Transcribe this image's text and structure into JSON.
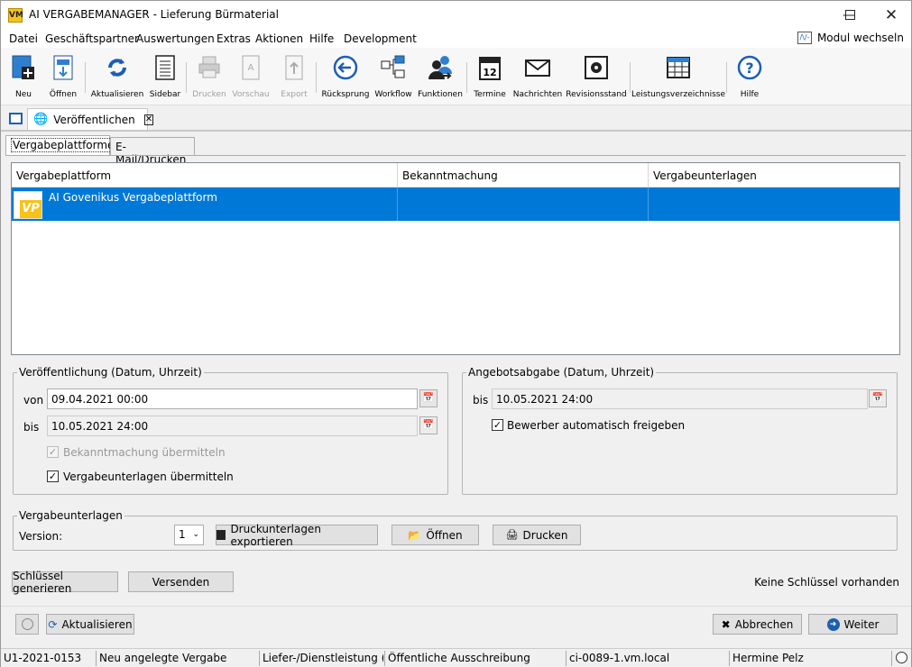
{
  "window": {
    "title": "AI VERGABEMANAGER - Lieferung Bürmaterial",
    "icon_text": "VM"
  },
  "menu": {
    "items": [
      "Datei",
      "Geschäftspartner",
      "Auswertungen",
      "Extras",
      "Aktionen",
      "Hilfe",
      "Development"
    ],
    "modul_label": "Modul wechseln"
  },
  "toolbar": {
    "neu": "Neu",
    "oeffnen": "Öffnen",
    "aktualisieren": "Aktualisieren",
    "sidebar": "Sidebar",
    "drucken": "Drucken",
    "vorschau": "Vorschau",
    "export": "Export",
    "ruecksprung": "Rücksprung",
    "workflow": "Workflow",
    "funktionen": "Funktionen",
    "termine": "Termine",
    "termine_num": "12",
    "nachrichten": "Nachrichten",
    "revisionsstand": "Revisionsstand",
    "leistungsverzeichnisse": "Leistungsverzeichnisse",
    "hilfe": "Hilfe"
  },
  "doc_tab": {
    "label": "Veröffentlichen"
  },
  "tabs": {
    "vergabeplattformen": "Vergabeplattformen",
    "email_drucken": "E-Mail/Drucken"
  },
  "table": {
    "headers": [
      "Vergabeplattform",
      "Bekanntmachung",
      "Vergabeunterlagen"
    ],
    "rows": [
      {
        "platform": "AI Govenikus Vergabeplattform",
        "logo": "VP",
        "bekanntmachung": "",
        "vergabeunterlagen": ""
      }
    ]
  },
  "veroeffentlichung": {
    "legend": "Veröffentlichung (Datum, Uhrzeit)",
    "von_label": "von",
    "von_value": "09.04.2021 00:00",
    "bis_label": "bis",
    "bis_value": "10.05.2021 24:00",
    "chk_bekanntmachung": "Bekanntmachung übermitteln",
    "chk_vergabeunterlagen": "Vergabeunterlagen übermitteln"
  },
  "angebotsabgabe": {
    "legend": "Angebotsabgabe (Datum, Uhrzeit)",
    "bis_label": "bis",
    "bis_value": "10.05.2021 24:00",
    "chk_bewerber": "Bewerber automatisch freigeben"
  },
  "vergabeunterlagen": {
    "legend": "Vergabeunterlagen",
    "version_label": "Version:",
    "version_value": "1",
    "btn_export": "Druckunterlagen exportieren",
    "btn_oeffnen": "Öffnen",
    "btn_drucken": "Drucken"
  },
  "keys": {
    "btn_generieren": "Schlüssel generieren",
    "btn_versenden": "Versenden",
    "status": "Keine Schlüssel vorhanden"
  },
  "footer": {
    "btn_aktualisieren": "Aktualisieren",
    "btn_abbrechen": "Abbrechen",
    "btn_weiter": "Weiter"
  },
  "statusbar": {
    "id": "U1-2021-0153",
    "status": "Neu angelegte Vergabe",
    "art": "Liefer-/Dienstleistung (...",
    "verfahren": "Öffentliche Ausschreibung",
    "server": "ci-0089-1.vm.local",
    "user": "Hermine Pelz"
  },
  "colors": {
    "selection": "#0078d7",
    "accent_blue": "#1b5fb3",
    "logo_yellow": "#f7c21a"
  }
}
